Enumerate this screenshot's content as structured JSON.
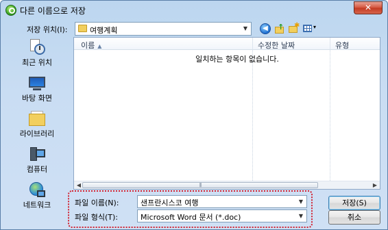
{
  "window": {
    "title": "다른 이름으로 저장",
    "close_label": "✕"
  },
  "location": {
    "label": "저장 위치(I):",
    "current_folder": "여행계획"
  },
  "toolbar": {
    "back_glyph": "◀",
    "up_glyph": "↑",
    "newfolder_glyph": "✱",
    "views_dropdown_glyph": "▾"
  },
  "places": [
    {
      "label": "최근 위치",
      "icon": "recent-places-icon"
    },
    {
      "label": "바탕 화면",
      "icon": "desktop-icon"
    },
    {
      "label": "라이브러리",
      "icon": "libraries-icon"
    },
    {
      "label": "컴퓨터",
      "icon": "computer-icon"
    },
    {
      "label": "네트워크",
      "icon": "network-icon"
    }
  ],
  "file_list": {
    "columns": [
      "이름",
      "수정한 날짜",
      "유형"
    ],
    "sort_indicator": "▲",
    "empty_message": "일치하는 항목이 없습니다.",
    "scroll_left": "◀",
    "scroll_right": "▶",
    "thumb_grip": "|||"
  },
  "form": {
    "file_name_label": "파일 이름(N):",
    "file_name_value": "샌프란시스코 여행",
    "file_type_label": "파일 형식(T):",
    "file_type_value": "Microsoft Word 문서 (*.doc)",
    "dropdown_arrow": "▼"
  },
  "buttons": {
    "save": "저장(S)",
    "cancel": "취소"
  },
  "colors": {
    "highlight_border": "#d2202f",
    "dialog_background": "#c9ddf3"
  }
}
